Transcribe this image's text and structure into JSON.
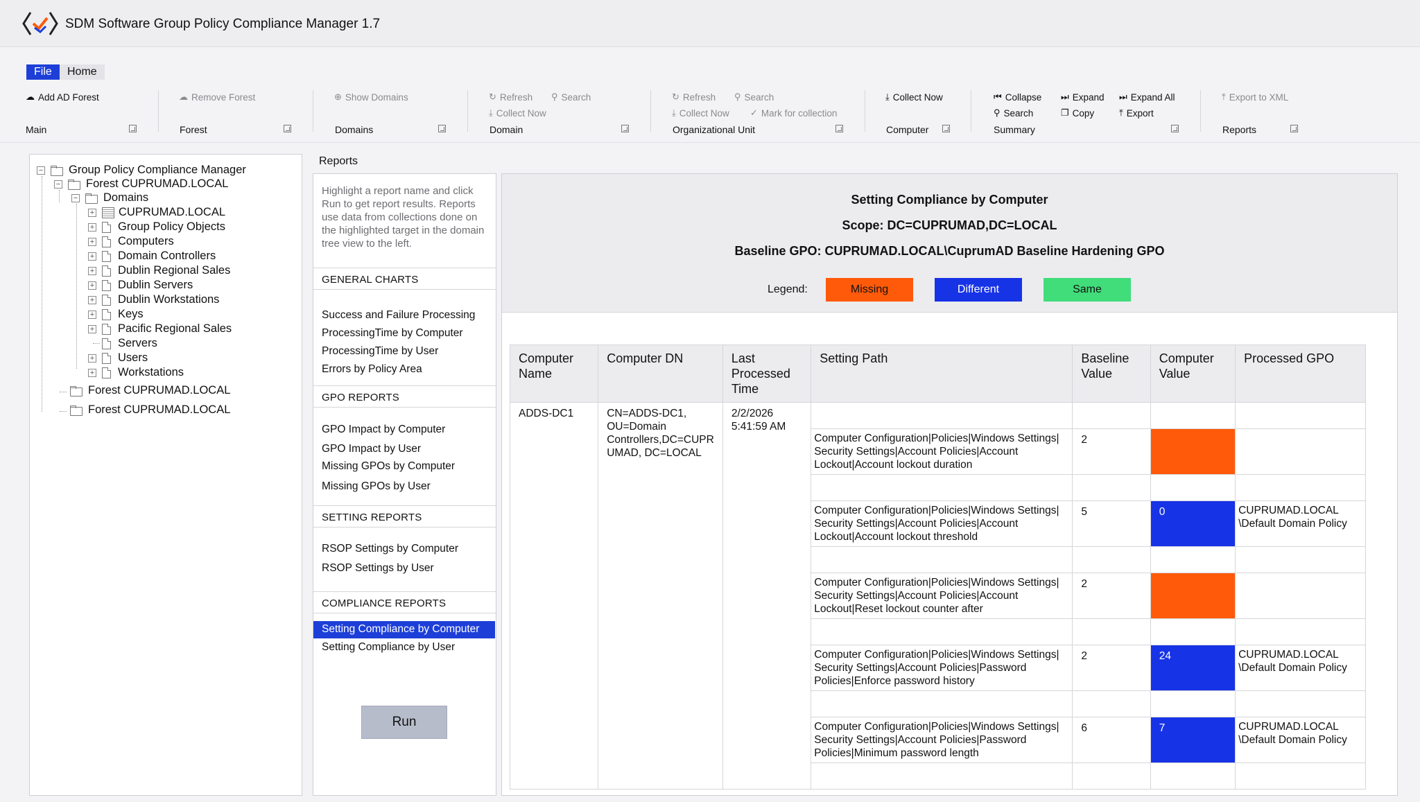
{
  "app": {
    "title": "SDM Software Group Policy Compliance Manager 1.7"
  },
  "menu": {
    "tabs": [
      "File",
      "Home"
    ]
  },
  "ribbon": {
    "groups": [
      {
        "name": "Main",
        "buttons": [
          "Add AD Forest"
        ]
      },
      {
        "name": "Forest",
        "buttons": [
          "Remove Forest"
        ]
      },
      {
        "name": "Domains",
        "buttons": [
          "Show Domains"
        ]
      },
      {
        "name": "Domain",
        "buttons": [
          "Refresh",
          "Search",
          "Collect Now"
        ]
      },
      {
        "name": "Organizational Unit",
        "buttons": [
          "Refresh",
          "Search",
          "Collect Now",
          "Mark for collection"
        ]
      },
      {
        "name": "Computer",
        "buttons": [
          "Collect Now"
        ]
      },
      {
        "name": "Summary",
        "buttons": [
          "Collapse",
          "Expand",
          "Expand All",
          "Search",
          "Copy",
          "Export"
        ]
      },
      {
        "name": "Reports",
        "buttons": [
          "Export to XML"
        ]
      }
    ]
  },
  "tree": {
    "root": "Group Policy Compliance Manager",
    "forest": "Forest CUPRUMAD.LOCAL",
    "domains": "Domains",
    "domain": "CUPRUMAD.LOCAL",
    "children": [
      "Group Policy Objects",
      "Computers",
      "Domain Controllers",
      "Dublin Regional Sales",
      "Dublin Servers",
      "Dublin Workstations",
      "Keys",
      "Pacific Regional Sales",
      "Servers",
      "Users",
      "Workstations"
    ],
    "other_forests": [
      "Forest CUPRUMAD.LOCAL",
      "Forest CUPRUMAD.LOCAL"
    ]
  },
  "reports": {
    "label": "Reports",
    "help": "Highlight a report name and click Run to get report results. Reports use data from collections done on the highlighted target in the domain tree view to the left.",
    "sections": [
      {
        "title": "GENERAL CHARTS",
        "items": [
          "Success and Failure Processing",
          "ProcessingTime by Computer",
          "ProcessingTime by User",
          "Errors by Policy Area"
        ]
      },
      {
        "title": "GPO REPORTS",
        "items": [
          "GPO Impact by Computer",
          "GPO Impact by User",
          "Missing GPOs by Computer",
          "Missing GPOs by User"
        ]
      },
      {
        "title": "SETTING REPORTS",
        "items": [
          "RSOP Settings by Computer",
          "RSOP Settings by User"
        ]
      },
      {
        "title": "COMPLIANCE REPORTS",
        "items": [
          "Setting Compliance by Computer",
          "Setting Compliance by User"
        ]
      }
    ],
    "selected": "Setting Compliance by Computer",
    "run_label": "Run"
  },
  "output": {
    "title": "Setting Compliance by Computer",
    "scope": "Scope: DC=CUPRUMAD,DC=LOCAL",
    "baseline": "Baseline GPO: CUPRUMAD.LOCAL\\CuprumAD Baseline Hardening GPO",
    "legend_label": "Legend:",
    "legend": {
      "missing": "Missing",
      "different": "Different",
      "same": "Same"
    },
    "colors": {
      "missing": "#ff5a0a",
      "different": "#1733e6",
      "same": "#41dd7b",
      "selection": "#1d3fd8"
    },
    "columns": [
      "Computer Name",
      "Computer DN",
      "Last Processed Time",
      "Setting Path",
      "Baseline Value",
      "Computer Value",
      "Processed GPO"
    ],
    "computer_name": "ADDS-DC1",
    "computer_dn": "CN=ADDS-DC1, OU=Domain Controllers,DC=CUPR UMAD, DC=LOCAL",
    "last_processed": "2/2/2026 5:41:59 AM",
    "rows": [
      {
        "path": "Computer Configuration|Policies|Windows Settings| Security Settings|Account Policies|Account Lockout|Account lockout duration",
        "baseline": "2",
        "computer": "",
        "status": "missing",
        "gpo": ""
      },
      {
        "path": "Computer Configuration|Policies|Windows Settings| Security Settings|Account Policies|Account Lockout|Account lockout threshold",
        "baseline": "5",
        "computer": "0",
        "status": "different",
        "gpo": "CUPRUMAD.LOCAL \\Default Domain Policy"
      },
      {
        "path": "Computer Configuration|Policies|Windows Settings| Security Settings|Account Policies|Account Lockout|Reset lockout counter after",
        "baseline": "2",
        "computer": "",
        "status": "missing",
        "gpo": ""
      },
      {
        "path": "Computer Configuration|Policies|Windows Settings| Security Settings|Account Policies|Password Policies|Enforce password history",
        "baseline": "2",
        "computer": "24",
        "status": "different",
        "gpo": "CUPRUMAD.LOCAL \\Default Domain Policy"
      },
      {
        "path": "Computer Configuration|Policies|Windows Settings| Security Settings|Account Policies|Password Policies|Minimum password length",
        "baseline": "6",
        "computer": "7",
        "status": "different",
        "gpo": "CUPRUMAD.LOCAL \\Default Domain Policy"
      }
    ]
  }
}
